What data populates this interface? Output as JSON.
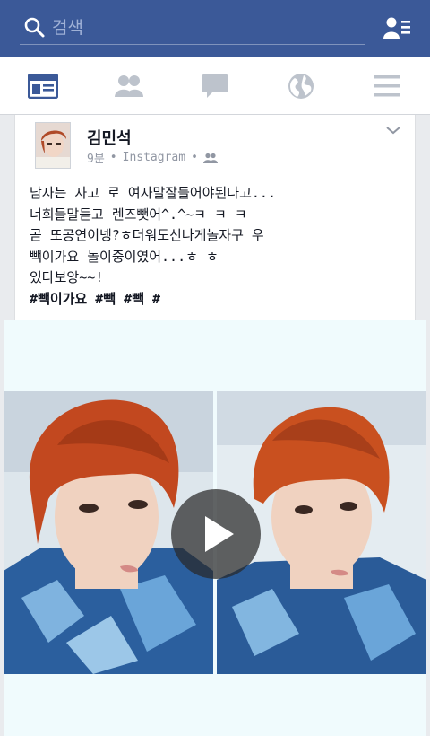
{
  "search": {
    "placeholder": "검색"
  },
  "nav": {
    "tabs": [
      {
        "name": "news-feed",
        "active": true
      },
      {
        "name": "friend-requests",
        "active": false
      },
      {
        "name": "messages",
        "active": false
      },
      {
        "name": "notifications",
        "active": false
      },
      {
        "name": "more",
        "active": false
      }
    ]
  },
  "post": {
    "author": "김민석",
    "time": "9분",
    "separator": "•",
    "source": "Instagram",
    "text_lines": [
      "남자는 자고 로 여자말잘들어야된다고...",
      "너희들말듣고 렌즈뺏어^.^~ㅋ ㅋ ㅋ",
      "곧 또공연이넹?ㅎ더워도신나게놀자구 우",
      "빽이가요 놀이중이였어...ㅎ ㅎ",
      "있다보앙~~!"
    ],
    "hashtags": "#빽이가요 #빽 #빽  #"
  },
  "colors": {
    "brand_blue": "#3b5998",
    "nav_icon": "#bdc3cc",
    "nav_icon_active": "#3b5998"
  }
}
